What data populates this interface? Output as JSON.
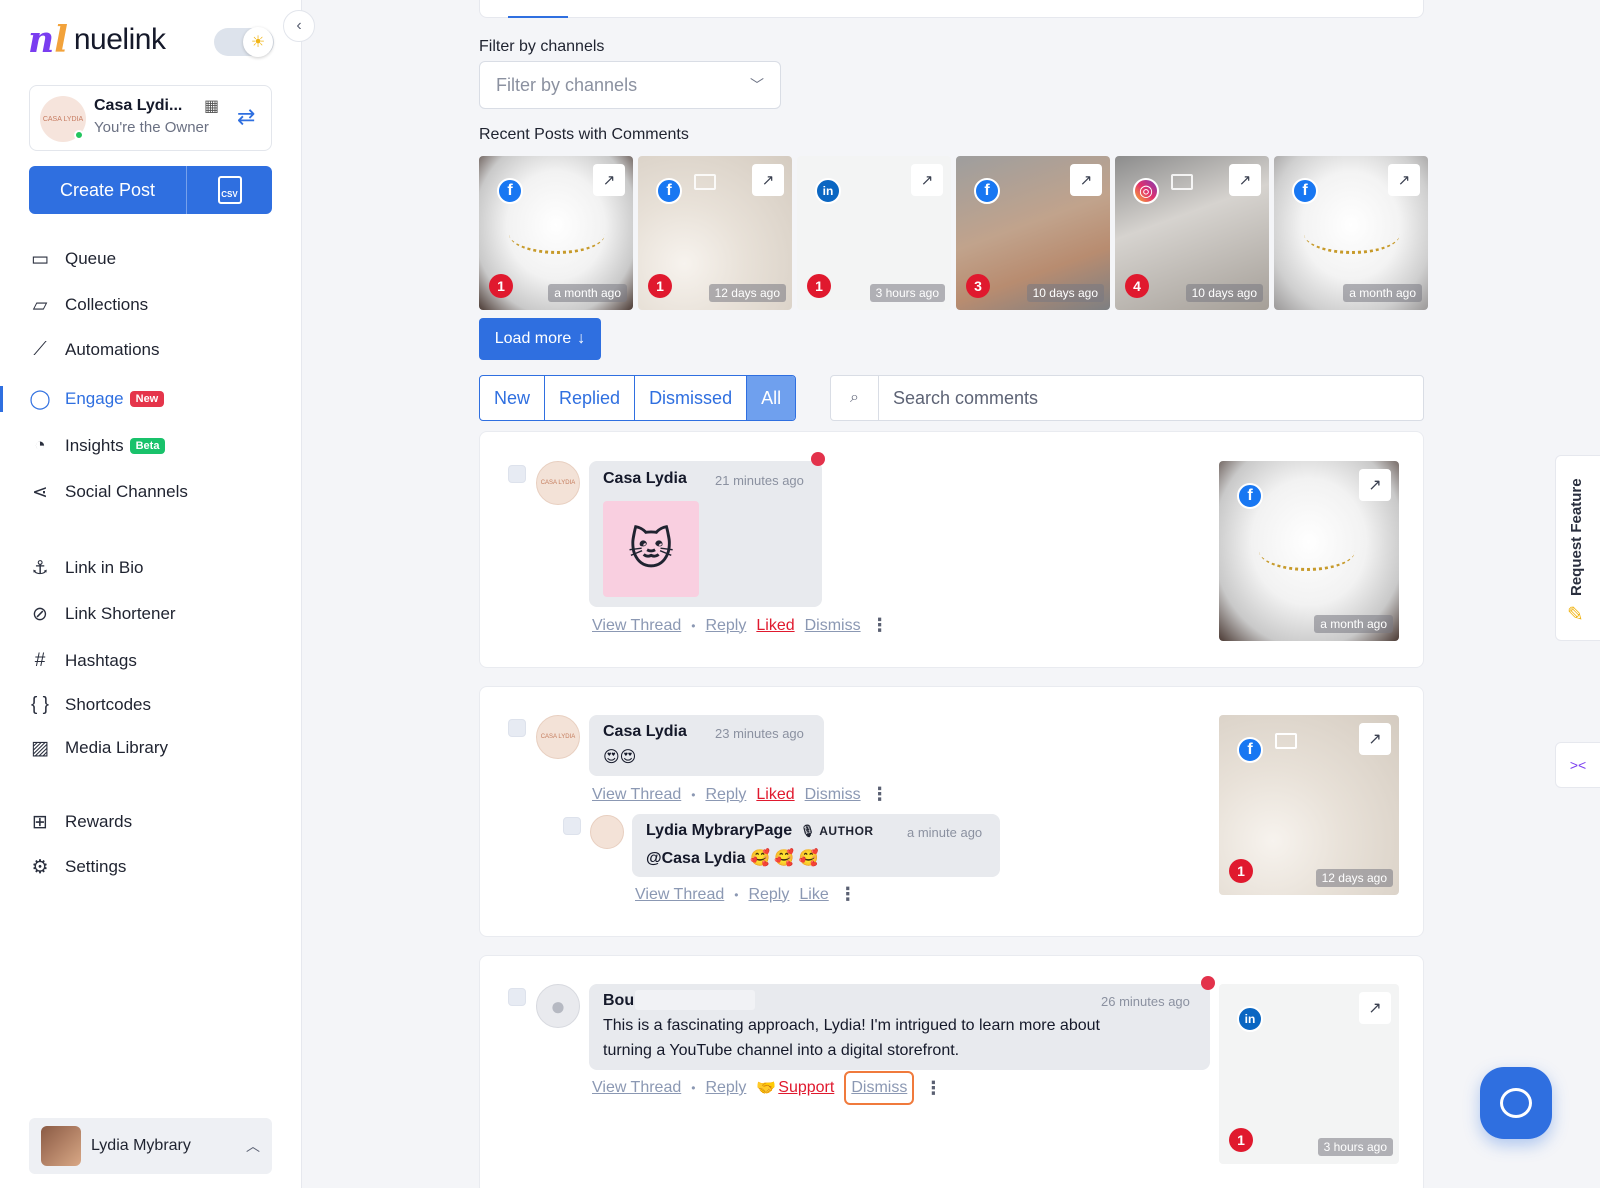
{
  "brand": {
    "logo_mark": "nl",
    "name": "nuelink"
  },
  "workspace": {
    "name": "Casa Lydi...",
    "role": "You're the Owner",
    "avatar_label": "CASA LYDIA"
  },
  "create_post": {
    "label": "Create Post",
    "csv_label": "CSV"
  },
  "nav": {
    "queue": "Queue",
    "collections": "Collections",
    "automations": "Automations",
    "engage": "Engage",
    "engage_badge": "New",
    "insights": "Insights",
    "insights_badge": "Beta",
    "social_channels": "Social Channels",
    "link_in_bio": "Link in Bio",
    "link_shortener": "Link Shortener",
    "hashtags": "Hashtags",
    "shortcodes": "Shortcodes",
    "media_library": "Media Library",
    "rewards": "Rewards",
    "settings": "Settings"
  },
  "user": {
    "name": "Lydia Mybrary"
  },
  "filter": {
    "label": "Filter by channels",
    "placeholder": "Filter by channels"
  },
  "recent": {
    "label": "Recent Posts with Comments",
    "posts": [
      {
        "network": "facebook",
        "network_glyph": "f",
        "count": "1",
        "ago": "a month ago"
      },
      {
        "network": "facebook",
        "network_glyph": "f",
        "count": "1",
        "ago": "12 days ago"
      },
      {
        "network": "linkedin",
        "network_glyph": "in",
        "count": "1",
        "ago": "3 hours ago"
      },
      {
        "network": "facebook",
        "network_glyph": "f",
        "count": "3",
        "ago": "10 days ago"
      },
      {
        "network": "instagram",
        "network_glyph": "◎",
        "count": "4",
        "ago": "10 days ago"
      },
      {
        "network": "facebook",
        "network_glyph": "f",
        "count": "",
        "ago": "a month ago"
      }
    ],
    "load_more": "Load more"
  },
  "tabs": {
    "new": "New",
    "replied": "Replied",
    "dismissed": "Dismissed",
    "all": "All",
    "selected": "All"
  },
  "search": {
    "placeholder": "Search comments"
  },
  "comments": [
    {
      "author": "Casa Lydia",
      "time": "21 minutes ago",
      "sticker": "🐱",
      "actions": {
        "view": "View Thread",
        "reply": "Reply",
        "like": "Liked",
        "dismiss": "Dismiss"
      },
      "post": {
        "network_glyph": "f",
        "ago": "a month ago"
      }
    },
    {
      "author": "Casa Lydia",
      "time": "23 minutes ago",
      "text": "😍😍",
      "actions": {
        "view": "View Thread",
        "reply": "Reply",
        "like": "Liked",
        "dismiss": "Dismiss"
      },
      "reply": {
        "author": "Lydia MybraryPage",
        "tag": "AUTHOR",
        "time": "a minute ago",
        "text": "@Casa Lydia 🥰 🥰 🥰",
        "actions": {
          "view": "View Thread",
          "reply": "Reply",
          "like": "Like"
        }
      },
      "post": {
        "network_glyph": "f",
        "count": "1",
        "ago": "12 days ago"
      }
    },
    {
      "author": "Bou",
      "time": "26 minutes ago",
      "text_line1": "This is a fascinating approach, Lydia! I'm intrigued to learn more about",
      "text_line2": "turning a YouTube channel into a digital storefront.",
      "actions": {
        "view": "View Thread",
        "reply": "Reply",
        "support": "Support",
        "dismiss": "Dismiss"
      },
      "post": {
        "network_glyph": "in",
        "count": "1",
        "ago": "3 hours ago"
      }
    }
  ],
  "request_feature": "Request Feature",
  "colors": {
    "accent": "#2f6fe0",
    "danger": "#e0192e",
    "facebook": "#1877f2",
    "linkedin": "#0a66c2"
  }
}
